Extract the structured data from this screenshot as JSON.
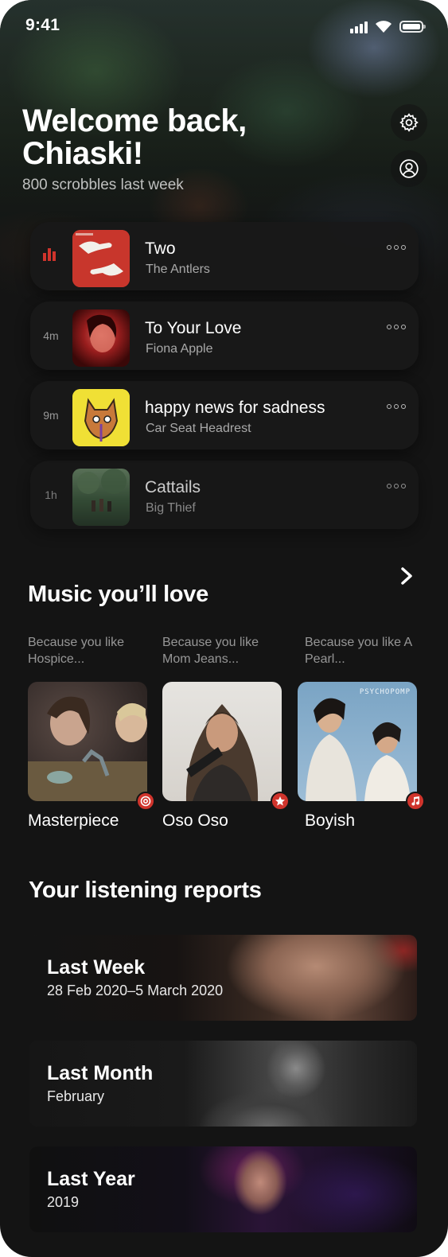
{
  "status_bar": {
    "time": "9:41"
  },
  "header": {
    "greeting": "Welcome back, Chiaski!",
    "subtitle": "800 scrobbles last week"
  },
  "recent_tracks": [
    {
      "time": "",
      "now_playing": true,
      "title": "Two",
      "artist": "The Antlers"
    },
    {
      "time": "4m",
      "now_playing": false,
      "title": "To Your Love",
      "artist": "Fiona Apple"
    },
    {
      "time": "9m",
      "now_playing": false,
      "title": "happy news for sadness",
      "artist": "Car Seat Headrest"
    },
    {
      "time": "1h",
      "now_playing": false,
      "title": "Cattails",
      "artist": "Big Thief"
    }
  ],
  "recommendations": {
    "title": "Music you’ll love",
    "items": [
      {
        "reason": "Because you like Hospice...",
        "name": "Masterpiece",
        "badge_icon": "target-icon"
      },
      {
        "reason": "Because you like Mom Jeans...",
        "name": "Oso Oso",
        "badge_icon": "star-icon"
      },
      {
        "reason": "Because you like A Pearl...",
        "name": "Boyish",
        "badge_icon": "music-note-icon",
        "cover_text": "PSYCHOPOMP"
      }
    ]
  },
  "reports": {
    "title": "Your listening reports",
    "items": [
      {
        "title": "Last Week",
        "period": "28 Feb 2020–5 March 2020"
      },
      {
        "title": "Last Month",
        "period": "February"
      },
      {
        "title": "Last Year",
        "period": "2019"
      }
    ]
  },
  "colors": {
    "accent": "#d0342c",
    "background": "#141414",
    "card": "#181818"
  }
}
